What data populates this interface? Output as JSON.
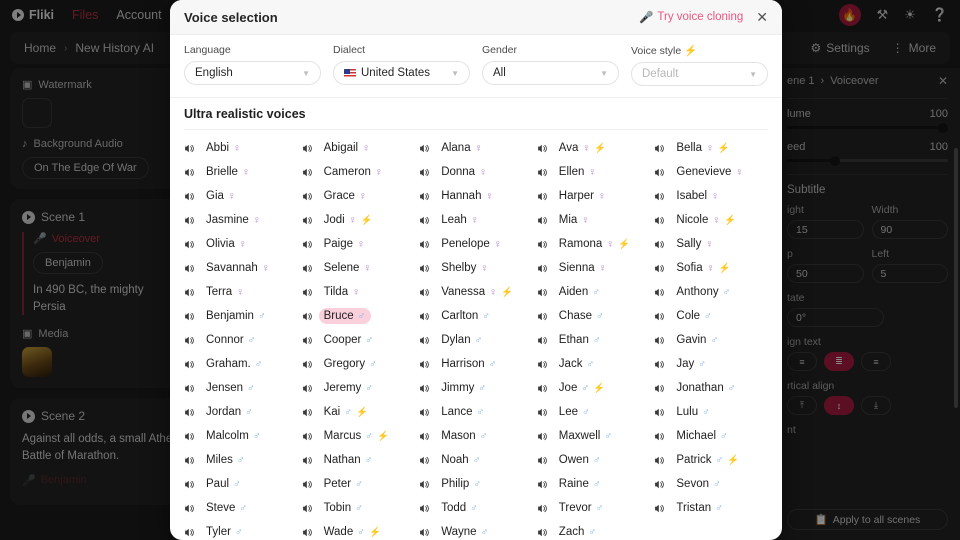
{
  "app": {
    "brand": "Fliki",
    "nav": [
      {
        "label": "Files",
        "active": true
      },
      {
        "label": "Account",
        "active": false
      }
    ],
    "icons": {
      "flame": "flame-icon",
      "tools": "tools-icon",
      "brightness": "brightness-icon",
      "help": "help-icon"
    },
    "breadcrumb": {
      "home": "Home",
      "sep": "›",
      "project": "New History AI"
    },
    "subbar": {
      "settings": "Settings",
      "more": "More",
      "gear": "gear-icon",
      "kebab": "kebab-icon"
    }
  },
  "left_panel": {
    "watermark_label": "Watermark",
    "background_audio_label": "Background Audio",
    "background_audio_value": "On The Edge Of War",
    "scene1": {
      "title": "Scene 1",
      "voiceover_label": "Voiceover",
      "voice_chip": "Benjamin",
      "text": "In 490 BC, the mighty Persia",
      "media_label": "Media"
    },
    "scene2": {
      "title": "Scene 2",
      "text": "Against all odds, a small Athe Battle of Marathon.",
      "voice_chip": "Benjamin"
    }
  },
  "right_panel": {
    "breadcrumb_scene": "ene 1",
    "breadcrumb_sep": "›",
    "breadcrumb_section": "Voiceover",
    "close": "✕",
    "volume_label": "lume",
    "volume_value": "100",
    "speed_label": "eed",
    "speed_value": "100",
    "subtitle_label": "Subtitle",
    "height_label": "ight",
    "height_value": "15",
    "width_label": "Width",
    "width_value": "90",
    "top_label": "p",
    "top_value": "50",
    "left_label": "Left",
    "left_value": "5",
    "rotate_label": "tate",
    "rotate_value": "0°",
    "align_text_label": "ign text",
    "align_text_options": [
      "≡",
      "≣",
      "≡"
    ],
    "align_text_selected": 1,
    "vertical_align_label": "rtical align",
    "vertical_align_options": [
      "⤒",
      "↕",
      "⤓"
    ],
    "vertical_align_selected": 1,
    "font_label": "nt",
    "apply_all_label": "Apply to all scenes",
    "apply_icon": "copy-icon"
  },
  "modal": {
    "title": "Voice selection",
    "clone_label": "Try voice cloning",
    "clone_icon": "microphone-icon",
    "close_label": "✕",
    "filters": [
      {
        "label": "Language",
        "value": "English",
        "flag": false,
        "disabled": false
      },
      {
        "label": "Dialect",
        "value": "United States",
        "flag": true,
        "disabled": false
      },
      {
        "label": "Gender",
        "value": "All",
        "flag": false,
        "disabled": false
      },
      {
        "label": "Voice style ⚡",
        "value": "Default",
        "flag": false,
        "disabled": true
      }
    ],
    "section_title": "Ultra realistic voices",
    "selected_voice": "Bruce",
    "voices": [
      {
        "name": "Abbi",
        "gender": "f",
        "pro": false
      },
      {
        "name": "Abigail",
        "gender": "f",
        "pro": false
      },
      {
        "name": "Alana",
        "gender": "f",
        "pro": false
      },
      {
        "name": "Ava",
        "gender": "f",
        "pro": true
      },
      {
        "name": "Bella",
        "gender": "f",
        "pro": true
      },
      {
        "name": "Brielle",
        "gender": "f",
        "pro": false
      },
      {
        "name": "Cameron",
        "gender": "f",
        "pro": false
      },
      {
        "name": "Donna",
        "gender": "f",
        "pro": false
      },
      {
        "name": "Ellen",
        "gender": "f",
        "pro": false
      },
      {
        "name": "Genevieve",
        "gender": "f",
        "pro": false
      },
      {
        "name": "Gia",
        "gender": "f",
        "pro": false
      },
      {
        "name": "Grace",
        "gender": "f",
        "pro": false
      },
      {
        "name": "Hannah",
        "gender": "f",
        "pro": false
      },
      {
        "name": "Harper",
        "gender": "f",
        "pro": false
      },
      {
        "name": "Isabel",
        "gender": "f",
        "pro": false
      },
      {
        "name": "Jasmine",
        "gender": "f",
        "pro": false
      },
      {
        "name": "Jodi",
        "gender": "f",
        "pro": true
      },
      {
        "name": "Leah",
        "gender": "f",
        "pro": false
      },
      {
        "name": "Mia",
        "gender": "f",
        "pro": false
      },
      {
        "name": "Nicole",
        "gender": "f",
        "pro": true
      },
      {
        "name": "Olivia",
        "gender": "f",
        "pro": false
      },
      {
        "name": "Paige",
        "gender": "f",
        "pro": false
      },
      {
        "name": "Penelope",
        "gender": "f",
        "pro": false
      },
      {
        "name": "Ramona",
        "gender": "f",
        "pro": true
      },
      {
        "name": "Sally",
        "gender": "f",
        "pro": false
      },
      {
        "name": "Savannah",
        "gender": "f",
        "pro": false
      },
      {
        "name": "Selene",
        "gender": "f",
        "pro": false
      },
      {
        "name": "Shelby",
        "gender": "f",
        "pro": false
      },
      {
        "name": "Sienna",
        "gender": "f",
        "pro": false
      },
      {
        "name": "Sofia",
        "gender": "f",
        "pro": true
      },
      {
        "name": "Terra",
        "gender": "f",
        "pro": false
      },
      {
        "name": "Tilda",
        "gender": "f",
        "pro": false
      },
      {
        "name": "Vanessa",
        "gender": "f",
        "pro": true
      },
      {
        "name": "Aiden",
        "gender": "m",
        "pro": false
      },
      {
        "name": "Anthony",
        "gender": "m",
        "pro": false
      },
      {
        "name": "Benjamin",
        "gender": "m",
        "pro": false
      },
      {
        "name": "Bruce",
        "gender": "m",
        "pro": false
      },
      {
        "name": "Carlton",
        "gender": "m",
        "pro": false
      },
      {
        "name": "Chase",
        "gender": "m",
        "pro": false
      },
      {
        "name": "Cole",
        "gender": "m",
        "pro": false
      },
      {
        "name": "Connor",
        "gender": "m",
        "pro": false
      },
      {
        "name": "Cooper",
        "gender": "m",
        "pro": false
      },
      {
        "name": "Dylan",
        "gender": "m",
        "pro": false
      },
      {
        "name": "Ethan",
        "gender": "m",
        "pro": false
      },
      {
        "name": "Gavin",
        "gender": "m",
        "pro": false
      },
      {
        "name": "Graham.",
        "gender": "m",
        "pro": false
      },
      {
        "name": "Gregory",
        "gender": "m",
        "pro": false
      },
      {
        "name": "Harrison",
        "gender": "m",
        "pro": false
      },
      {
        "name": "Jack",
        "gender": "m",
        "pro": false
      },
      {
        "name": "Jay",
        "gender": "m",
        "pro": false
      },
      {
        "name": "Jensen",
        "gender": "m",
        "pro": false
      },
      {
        "name": "Jeremy",
        "gender": "m",
        "pro": false
      },
      {
        "name": "Jimmy",
        "gender": "m",
        "pro": false
      },
      {
        "name": "Joe",
        "gender": "m",
        "pro": true
      },
      {
        "name": "Jonathan",
        "gender": "m",
        "pro": false
      },
      {
        "name": "Jordan",
        "gender": "m",
        "pro": false
      },
      {
        "name": "Kai",
        "gender": "m",
        "pro": true
      },
      {
        "name": "Lance",
        "gender": "m",
        "pro": false
      },
      {
        "name": "Lee",
        "gender": "m",
        "pro": false
      },
      {
        "name": "Lulu",
        "gender": "m",
        "pro": false
      },
      {
        "name": "Malcolm",
        "gender": "m",
        "pro": false
      },
      {
        "name": "Marcus",
        "gender": "m",
        "pro": true
      },
      {
        "name": "Mason",
        "gender": "m",
        "pro": false
      },
      {
        "name": "Maxwell",
        "gender": "m",
        "pro": false
      },
      {
        "name": "Michael",
        "gender": "m",
        "pro": false
      },
      {
        "name": "Miles",
        "gender": "m",
        "pro": false
      },
      {
        "name": "Nathan",
        "gender": "m",
        "pro": false
      },
      {
        "name": "Noah",
        "gender": "m",
        "pro": false
      },
      {
        "name": "Owen",
        "gender": "m",
        "pro": false
      },
      {
        "name": "Patrick",
        "gender": "m",
        "pro": true
      },
      {
        "name": "Paul",
        "gender": "m",
        "pro": false
      },
      {
        "name": "Peter",
        "gender": "m",
        "pro": false
      },
      {
        "name": "Philip",
        "gender": "m",
        "pro": false
      },
      {
        "name": "Raine",
        "gender": "m",
        "pro": false
      },
      {
        "name": "Sevon",
        "gender": "m",
        "pro": false
      },
      {
        "name": "Steve",
        "gender": "m",
        "pro": false
      },
      {
        "name": "Tobin",
        "gender": "m",
        "pro": false
      },
      {
        "name": "Todd",
        "gender": "m",
        "pro": false
      },
      {
        "name": "Trevor",
        "gender": "m",
        "pro": false
      },
      {
        "name": "Tristan",
        "gender": "m",
        "pro": false
      },
      {
        "name": "Tyler",
        "gender": "m",
        "pro": false
      },
      {
        "name": "Wade",
        "gender": "m",
        "pro": true
      },
      {
        "name": "Wayne",
        "gender": "m",
        "pro": false
      },
      {
        "name": "Zach",
        "gender": "m",
        "pro": false
      }
    ]
  },
  "colors": {
    "accent_pink": "#e8577f",
    "selected_bg": "#fbd0dd",
    "brand_red": "#a81d41",
    "female": "#b07fcf",
    "male": "#7fb4e0",
    "pro_bolt": "#f2c53d"
  }
}
